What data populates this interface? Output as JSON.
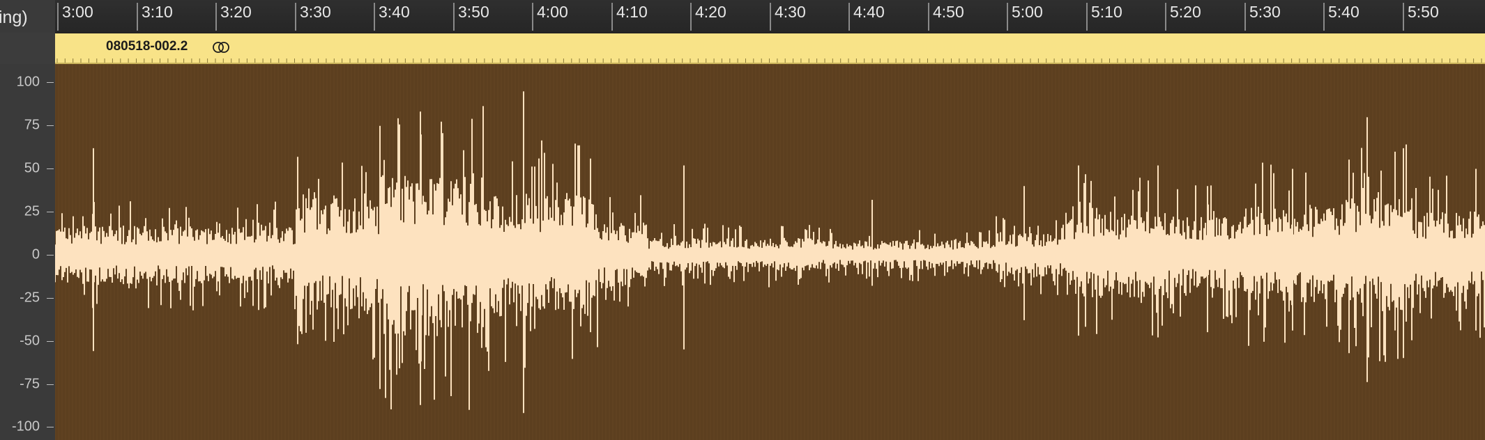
{
  "track": {
    "name": "ing)"
  },
  "ruler": {
    "labels": [
      "3:00",
      "3:10",
      "3:20",
      "3:30",
      "3:40",
      "3:50",
      "4:00",
      "4:10",
      "4:20",
      "4:30",
      "4:40",
      "4:50",
      "5:00",
      "5:10",
      "5:20",
      "5:30",
      "5:40",
      "5:50"
    ]
  },
  "region": {
    "name": "080518-002.2",
    "loop_icon": "loop-icon",
    "color": "#f8e388"
  },
  "y_axis": {
    "labels": [
      "100",
      "75",
      "50",
      "25",
      "0",
      "-25",
      "-50",
      "-75",
      "-100"
    ]
  },
  "colors": {
    "waveform_fill": "#fde2bf",
    "waveform_background": "#5c3f1f",
    "ruler_background": "#2b2b2b"
  }
}
